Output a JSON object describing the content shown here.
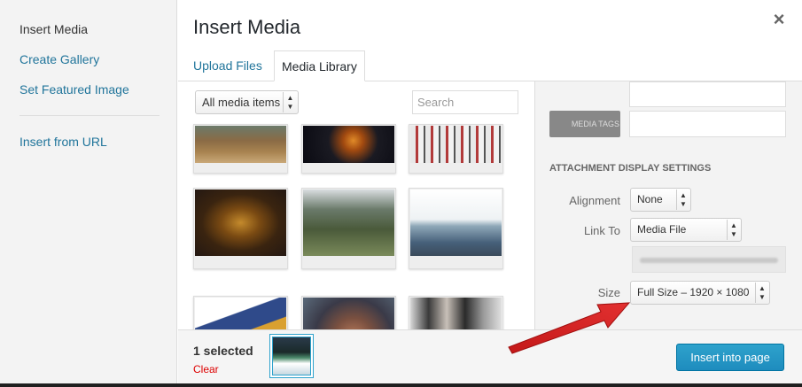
{
  "menu": {
    "items": [
      {
        "label": "Insert Media",
        "active": true
      },
      {
        "label": "Create Gallery"
      },
      {
        "label": "Set Featured Image"
      },
      {
        "label": "Insert from URL"
      }
    ]
  },
  "modal": {
    "title": "Insert Media",
    "close_icon": "close-icon",
    "tabs": [
      {
        "label": "Upload Files"
      },
      {
        "label": "Media Library",
        "active": true
      }
    ]
  },
  "browser": {
    "filter_selected": "All media items",
    "search_placeholder": "Search"
  },
  "sidebar": {
    "tags_button": "MEDIA TAGS",
    "section_title": "ATTACHMENT DISPLAY SETTINGS",
    "alignment_label": "Alignment",
    "alignment_value": "None",
    "link_to_label": "Link To",
    "link_to_value": "Media File",
    "size_label": "Size",
    "size_value": "Full Size – 1920 × 1080"
  },
  "toolbar": {
    "selected_count": "1 selected",
    "clear_label": "Clear",
    "insert_label": "Insert into page"
  },
  "colors": {
    "link": "#21759b",
    "primary_button": "#2ea2cc",
    "clear": "#dd0000",
    "arrow": "#d42020"
  }
}
